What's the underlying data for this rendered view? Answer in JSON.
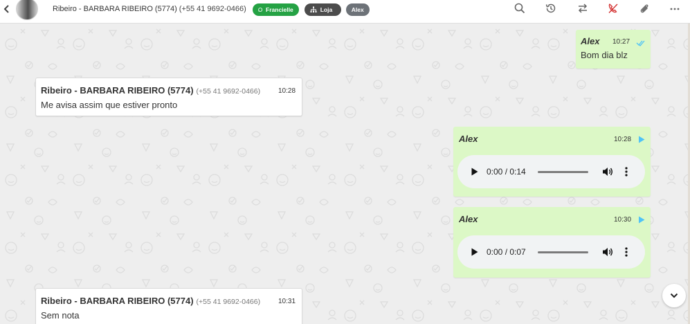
{
  "header": {
    "contact_name": "Ribeiro - BARBARA RIBEIRO (5774)",
    "contact_phone": "(+55 41 9692-0466)",
    "tags": [
      {
        "label": "Francielle",
        "icon": "whatsapp-icon",
        "color": "#25a244"
      },
      {
        "label": "Loja",
        "icon": "sitemap-icon",
        "color": "#4c4c4c"
      },
      {
        "label": "Alex",
        "color": "#6d7278"
      }
    ],
    "icons": [
      "search-icon",
      "history-icon",
      "transfer-icon",
      "end-call-icon",
      "attach-icon",
      "more-icon"
    ]
  },
  "messages": [
    {
      "direction": "out",
      "sender": "Alex",
      "time": "10:27",
      "text": "Bom dia blz",
      "status_icon": "double-check-icon"
    },
    {
      "direction": "in",
      "sender": "Ribeiro - BARBARA RIBEIRO (5774)",
      "phone": "(+55 41 9692-0466)",
      "time": "10:28",
      "text": "Me avisa assim que estiver pronto"
    },
    {
      "direction": "out",
      "sender": "Alex",
      "time": "10:28",
      "type": "audio",
      "audio_time": "0:00 / 0:14",
      "status_icon": "play-icon"
    },
    {
      "direction": "out",
      "sender": "Alex",
      "time": "10:30",
      "type": "audio",
      "audio_time": "0:00 / 0:07",
      "status_icon": "play-icon"
    },
    {
      "direction": "in",
      "sender": "Ribeiro - BARBARA RIBEIRO (5774)",
      "phone": "(+55 41 9692-0466)",
      "time": "10:31",
      "text": "Sem nota"
    }
  ],
  "colors": {
    "outgoing_bubble": "#dcf8c6",
    "incoming_bubble": "#ffffff",
    "accent_green": "#25a244",
    "read_check": "#4fc3f7",
    "end_call": "#d32f2f"
  }
}
